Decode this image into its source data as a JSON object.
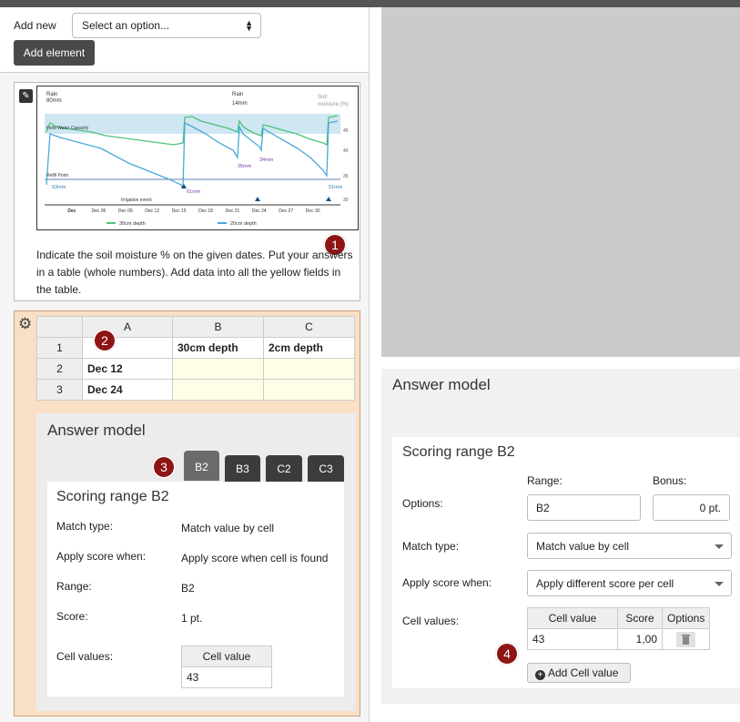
{
  "toolbar": {
    "add_new_label": "Add new",
    "select_value": "Select an option...",
    "add_element_button": "Add element"
  },
  "chart_card": {
    "prompt": "Indicate the soil moisture % on the given dates. Put your answers in a table (whole numbers). Add data into all the yellow fields in the table.",
    "badge": "1"
  },
  "chart_data": {
    "type": "line",
    "x": [
      "Dec",
      "Dec 06",
      "Dec 09",
      "Dec 12",
      "Dec 15",
      "Dec 18",
      "Dec 21",
      "Dec 24",
      "Dec 27",
      "Dec 30"
    ],
    "series": [
      {
        "name": "30cm depth",
        "color": "#4fc37a"
      },
      {
        "name": "20cm depth",
        "color": "#49a9d8"
      }
    ],
    "annotations": [
      "Rain",
      "80mm",
      "Rain",
      "14mm",
      "Soil",
      "moisture (%)",
      "Field Water Capacity",
      "Refill Point",
      "Irrigation event:",
      "53mm",
      "61mm",
      "35mm",
      "34mm",
      "51mm"
    ],
    "y_ticks": [
      "45",
      "40",
      "35",
      "30"
    ]
  },
  "sheet": {
    "columns": [
      "A",
      "B",
      "C"
    ],
    "rows": [
      {
        "num": "1",
        "a": "",
        "b": "30cm depth",
        "c": "2cm depth"
      },
      {
        "num": "2",
        "a": "Dec 12",
        "b": "",
        "c": ""
      },
      {
        "num": "3",
        "a": "Dec 24",
        "b": "",
        "c": ""
      }
    ],
    "badge": "2"
  },
  "answer_model_left": {
    "title": "Answer model",
    "tabs": [
      "B2",
      "B3",
      "C2",
      "C3"
    ],
    "badge": "3",
    "scoring_title": "Scoring range B2",
    "fields": [
      {
        "label": "Match type:",
        "value": "Match value by cell"
      },
      {
        "label": "Apply score when:",
        "value": "Apply score when cell is found"
      },
      {
        "label": "Range:",
        "value": "B2"
      },
      {
        "label": "Score:",
        "value": "1 pt."
      }
    ],
    "cell_values_label": "Cell values:",
    "cell_value_header": "Cell value",
    "cell_value": "43"
  },
  "answer_model_right": {
    "title": "Answer model",
    "scoring_title": "Scoring range B2",
    "range_label": "Range:",
    "bonus_label": "Bonus:",
    "options_label": "Options:",
    "range_value": "B2",
    "bonus_value": "0 pt.",
    "match_type_label": "Match type:",
    "match_type_value": "Match value by cell",
    "apply_label": "Apply score when:",
    "apply_value": "Apply different score per cell",
    "cell_values_label": "Cell values:",
    "table_headers": [
      "Cell value",
      "Score",
      "Options"
    ],
    "row": {
      "cell": "43",
      "score": "1,00"
    },
    "add_button": "Add Cell value",
    "badge": "4"
  }
}
